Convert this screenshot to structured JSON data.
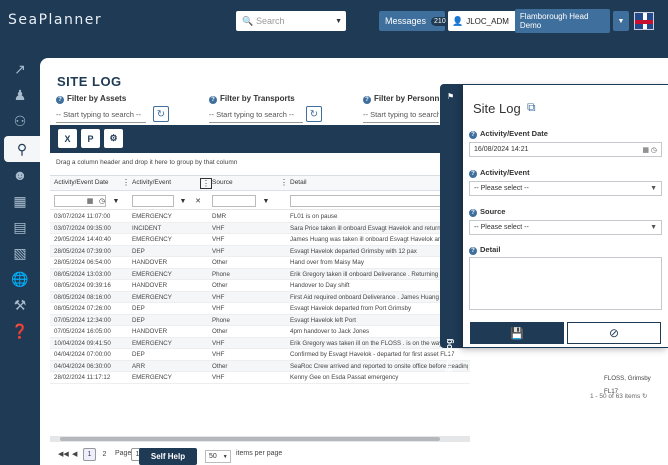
{
  "app": {
    "logo": "SeaPlanner"
  },
  "header": {
    "search_placeholder": "Search",
    "messages_label": "Messages",
    "messages_count": "210",
    "user_name": "JLOC_ADM",
    "site_name": "Flamborough Head Demo"
  },
  "page": {
    "title": "SITE LOG",
    "filters": [
      {
        "label": "Filter by Assets",
        "placeholder": "-- Start typing to search --"
      },
      {
        "label": "Filter by Transports",
        "placeholder": "-- Start typing to search --"
      },
      {
        "label": "Filter by Personnel",
        "placeholder": "-- Start typing to search --"
      }
    ],
    "group_hint": "Drag a column header and drop it here to group by that column"
  },
  "grid": {
    "columns": [
      "Activity/Event Date",
      "Activity/Event",
      "Source",
      "Detail"
    ],
    "rows": [
      [
        "03/07/2024 11:07:00",
        "EMERGENCY",
        "DMR",
        "FL01 is on pause"
      ],
      [
        "03/07/2024 09:35:00",
        "INCIDENT",
        "VHF",
        "Sara Price taken ill onboard Esvagt Havelok and returning"
      ],
      [
        "29/05/2024 14:40:40",
        "EMERGENCY",
        "VHF",
        "James Huang was taken ill onboard Esvagt Havelok and"
      ],
      [
        "28/05/2024 07:39:00",
        "DEP",
        "VHF",
        "Esvagt Havelok departed Grimsby with 12 pax"
      ],
      [
        "28/05/2024 06:54:00",
        "HANDOVER",
        "Other",
        "Hand over from Maisy May"
      ],
      [
        "08/05/2024 13:03:00",
        "EMERGENCY",
        "Phone",
        "Erik Gregory taken ill onboard Deliverance . Returning to"
      ],
      [
        "08/05/2024 09:39:16",
        "HANDOVER",
        "Other",
        "Handover to Day shift"
      ],
      [
        "08/05/2024 08:16:00",
        "EMERGENCY",
        "VHF",
        "First Aid required onboard Deliverance . James Huang is"
      ],
      [
        "08/05/2024 07:26:00",
        "DEP",
        "VHF",
        "Esvagt Havelok departed from Port Grimsby"
      ],
      [
        "07/05/2024 12:34:00",
        "DEP",
        "Phone",
        "Esvagt Havelok left Port"
      ],
      [
        "07/05/2024 16:05:00",
        "HANDOVER",
        "Other",
        "4pm handover to Jack Jones"
      ],
      [
        "10/04/2024 09:41:50",
        "EMERGENCY",
        "VHF",
        "Erik Gregory was taken ill on the FLOSS . is on the way back to Grimsby"
      ],
      [
        "04/04/2024 07:00:00",
        "DEP",
        "VHF",
        "Confirmed by Esvagt Havelok - departed for first asset FL17"
      ],
      [
        "04/04/2024 06:30:00",
        "ARR",
        "Other",
        "SeaRoc Crew arrived and reported to onsite office before heading to Pontoon"
      ],
      [
        "28/02/2024 11:17:12",
        "EMERGENCY",
        "VHF",
        "Kenny Gee on Esda Passat emergency"
      ]
    ],
    "extra_values": [
      "FLOSS, Grimsby",
      "FL17"
    ]
  },
  "pager": {
    "pages": [
      "1",
      "2"
    ],
    "page_label": "Page",
    "page_value": "1",
    "self_help": "Self Help",
    "page_size": "50",
    "page_size_label": "items per page",
    "range": "1 - 50 of 63 items"
  },
  "panel": {
    "tab_label": "Site Log",
    "title": "Site Log",
    "date_label": "Activity/Event Date",
    "date_value": "16/08/2024 14:21",
    "event_label": "Activity/Event",
    "event_placeholder": "-- Please select --",
    "source_label": "Source",
    "source_placeholder": "-- Please select --",
    "detail_label": "Detail"
  }
}
